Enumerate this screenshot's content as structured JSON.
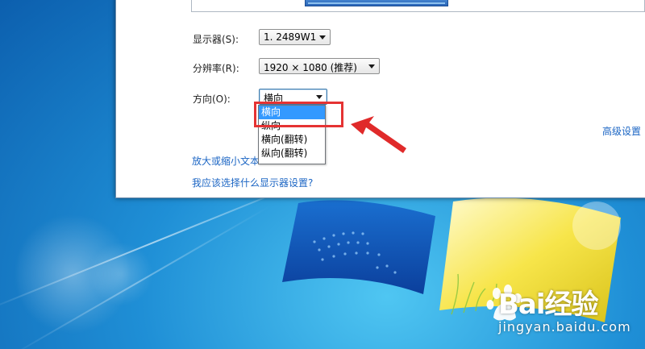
{
  "dialog": {
    "monitor_label": "显示器(S):",
    "monitor_value": "1. 2489W1",
    "resolution_label": "分辨率(R):",
    "resolution_value": "1920 × 1080 (推荐)",
    "orientation_label": "方向(O):",
    "orientation_value": "横向",
    "orientation_options": [
      "横向",
      "纵向",
      "横向(翻转)",
      "纵向(翻转)"
    ],
    "orientation_selected_index": 0,
    "advanced_link": "高级设置",
    "text_size_link": "放大或缩小文本",
    "help_link": "我应该选择什么显示器设置?"
  },
  "watermark": {
    "brand": "Bai经验",
    "url": "jingyan.baidu.com"
  },
  "colors": {
    "link": "#1c66c4",
    "highlight_box": "#e53333",
    "selected_option": "#3399ff"
  }
}
